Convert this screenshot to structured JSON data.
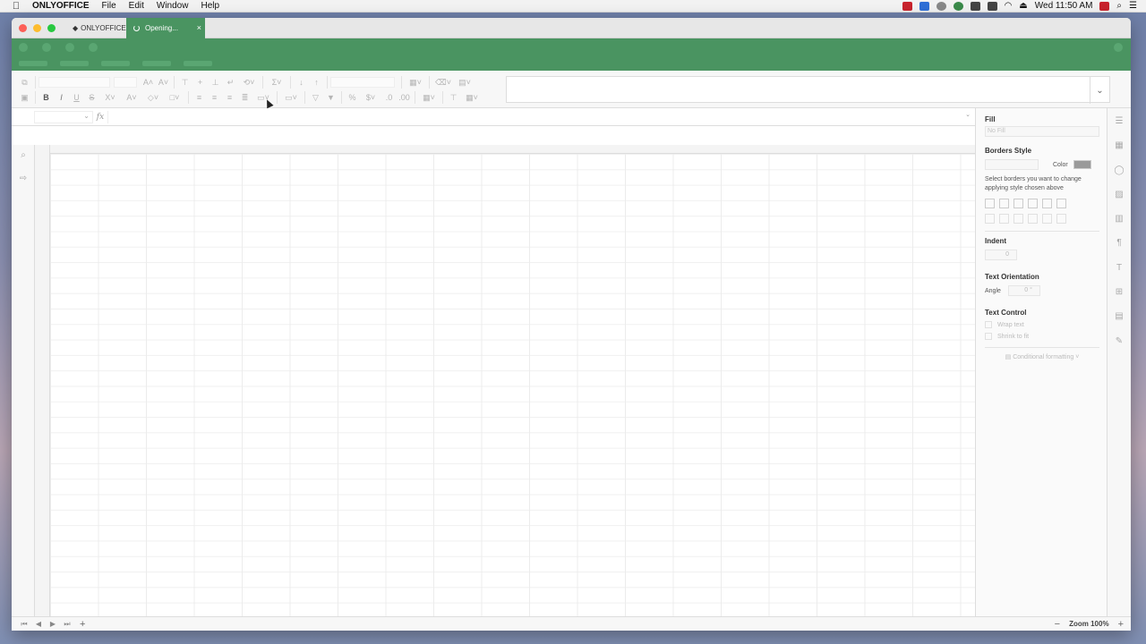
{
  "menubar": {
    "app_name": "ONLYOFFICE",
    "items": [
      "File",
      "Edit",
      "Window",
      "Help"
    ],
    "clock": "Wed 11:50 AM"
  },
  "tabs": {
    "home_label": "ONLYOFFICE",
    "active_label": "Opening...",
    "close_glyph": "×"
  },
  "formula_bar": {
    "fx_label": "fx"
  },
  "right_panel": {
    "fill_header": "Fill",
    "fill_value": "No Fill",
    "borders_header": "Borders Style",
    "color_label": "Color",
    "borders_hint": "Select borders you want to change applying style chosen above",
    "indent_header": "Indent",
    "indent_value": "0",
    "text_orientation_header": "Text Orientation",
    "angle_label": "Angle",
    "angle_value": "0 °",
    "text_control_header": "Text Control",
    "wrap_text_label": "Wrap text",
    "shrink_to_fit_label": "Shrink to fit",
    "conditional_formatting_label": "Conditional formatting"
  },
  "statusbar": {
    "zoom_label": "Zoom 100%",
    "zoom_out": "−",
    "zoom_in": "+",
    "add_sheet": "+"
  },
  "colors": {
    "brand_green": "#4a9461",
    "border_color_swatch": "#9a9a9a"
  }
}
